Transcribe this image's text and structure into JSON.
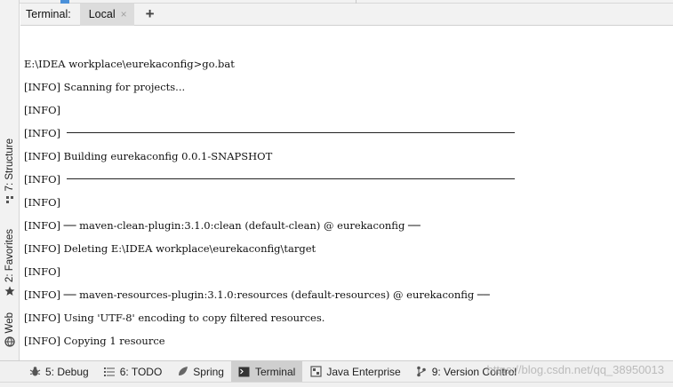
{
  "header": {
    "title": "Terminal:",
    "tab_label": "Local",
    "close_glyph": "×",
    "add_glyph": "+"
  },
  "left_strip": {
    "structure": "7: Structure",
    "favorites": "2: Favorites",
    "web": "Web"
  },
  "terminal": {
    "lines": [
      "E:\\IDEA workplace\\eurekaconfig>go.bat",
      "[INFO] Scanning for projects...",
      "[INFO]",
      "[INFO]",
      "[INFO] Building eurekaconfig 0.0.1-SNAPSHOT",
      "[INFO]",
      "[INFO]",
      "[INFO] ── maven-clean-plugin:3.1.0:clean (default-clean) @ eurekaconfig ──",
      "[INFO] Deleting E:\\IDEA workplace\\eurekaconfig\\target",
      "[INFO]",
      "[INFO] ── maven-resources-plugin:3.1.0:resources (default-resources) @ eurekaconfig ──",
      "[INFO] Using 'UTF-8' encoding to copy filtered resources.",
      "[INFO] Copying 1 resource"
    ]
  },
  "bottom_bar": {
    "debug": "5: Debug",
    "todo": "6: TODO",
    "spring": "Spring",
    "terminal": "Terminal",
    "java_enterprise": "Java Enterprise",
    "version_control": "9: Version Control"
  },
  "watermark": "https://blog.csdn.net/qq_38950013",
  "colors": {
    "active_tab": "#dcdcdc",
    "background": "#ffffff",
    "panel": "#f2f2f2"
  }
}
